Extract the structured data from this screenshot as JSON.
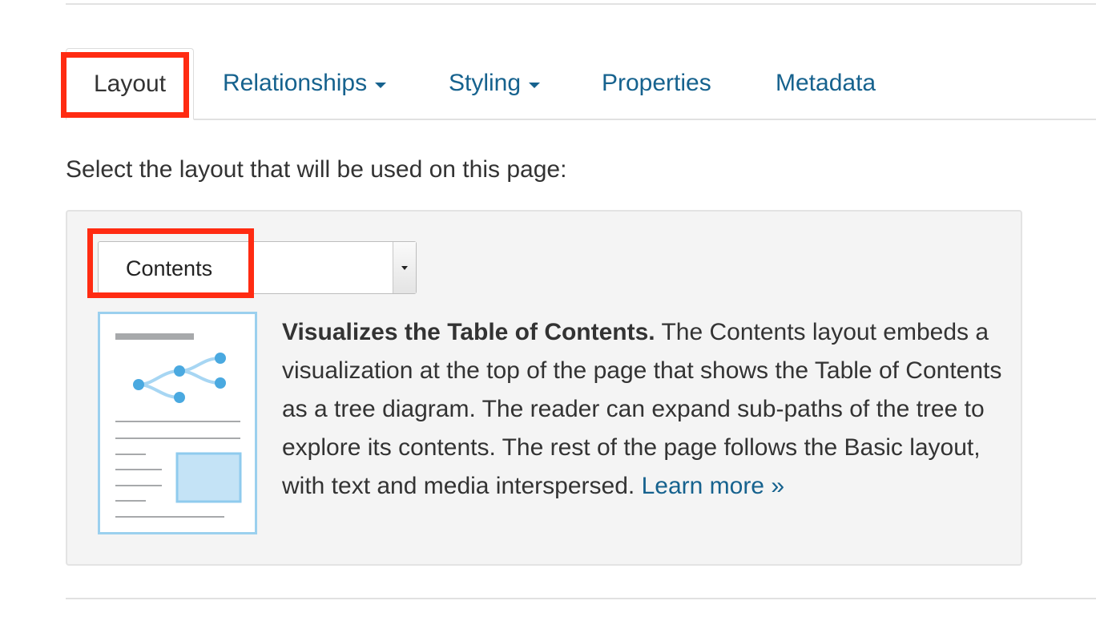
{
  "tabs": [
    {
      "label": "Layout",
      "active": true
    },
    {
      "label": "Relationships",
      "dropdown": true
    },
    {
      "label": "Styling",
      "dropdown": true
    },
    {
      "label": "Properties"
    },
    {
      "label": "Metadata"
    }
  ],
  "instructions": "Select the layout that will be used on this page:",
  "layout_select": {
    "value": "Contents"
  },
  "description": {
    "title": "Visualizes the Table of Contents.",
    "body": " The Contents layout embeds a visualization at the top of the page that shows the Table of Contents as a tree diagram. The reader can expand sub-paths of the tree to explore its contents. The rest of the page follows the Basic layout, with text and media interspersed. ",
    "link": "Learn more »"
  },
  "thumbnail_icon": "contents-layout-thumbnail-icon",
  "colors": {
    "link": "#16628e",
    "highlight": "#ff2b12",
    "panel_bg": "#f4f4f4",
    "thumb_blue": "#4aa9e0",
    "thumb_light_blue": "#c4e3f6"
  }
}
